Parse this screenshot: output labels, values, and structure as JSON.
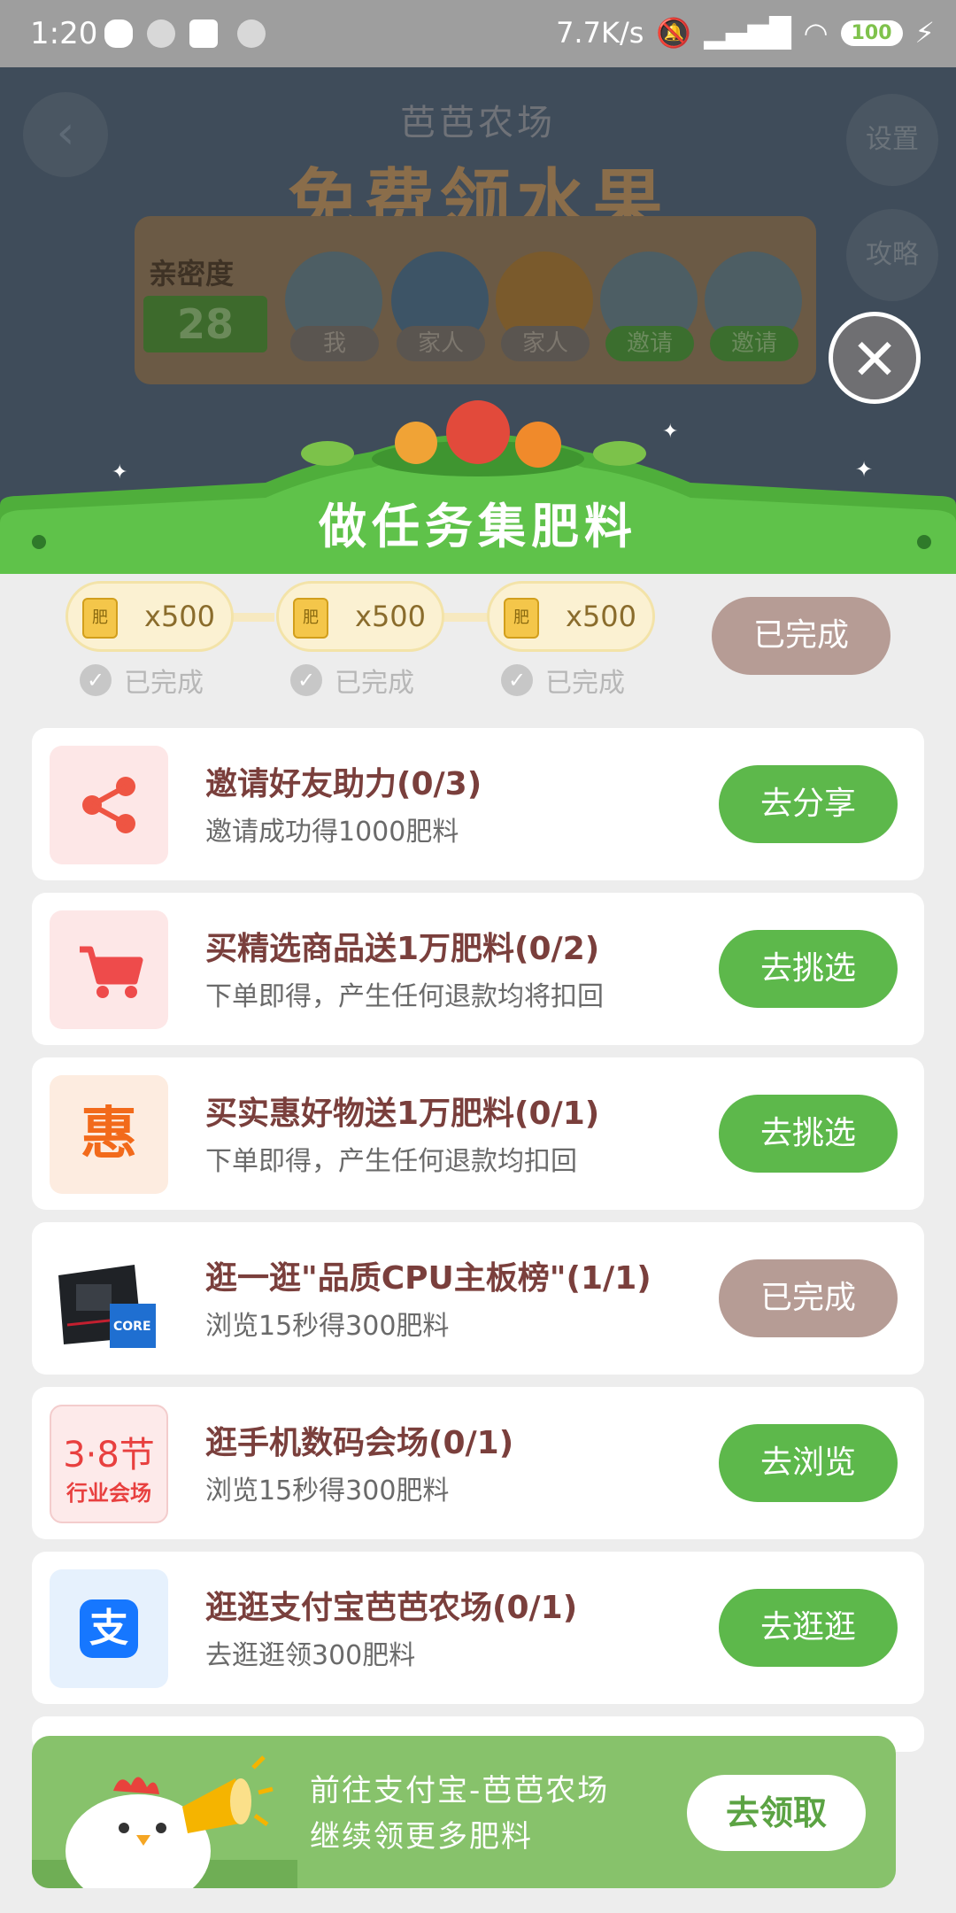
{
  "status_bar": {
    "time": "1:20",
    "net_speed": "7.7K/s",
    "battery": "100"
  },
  "background_game": {
    "app_name": "芭芭农场",
    "headline": "免费领水果",
    "settings_label": "设置",
    "guide_label": "攻略",
    "intimacy_label": "亲密度",
    "intimacy_value": "28",
    "members": [
      {
        "label": "我"
      },
      {
        "label": "家人"
      },
      {
        "label": "家人"
      },
      {
        "label": "邀请"
      },
      {
        "label": "邀请"
      }
    ]
  },
  "sheet": {
    "title": "做任务集肥料",
    "fert_icon_text": "肥",
    "progress": [
      {
        "amount": "x500",
        "status": "已完成"
      },
      {
        "amount": "x500",
        "status": "已完成"
      },
      {
        "amount": "x500",
        "status": "已完成"
      }
    ],
    "progress_button": "已完成",
    "tasks": [
      {
        "title": "邀请好友助力(0/3)",
        "subtitle": "邀请成功得1000肥料",
        "action": "去分享",
        "icon": "share-icon"
      },
      {
        "title": "买精选商品送1万肥料(0/2)",
        "subtitle": "下单即得，产生任何退款均将扣回",
        "action": "去挑选",
        "icon": "cart-icon"
      },
      {
        "title": "买实惠好物送1万肥料(0/1)",
        "subtitle": "下单即得，产生任何退款均扣回",
        "action": "去挑选",
        "icon": "hui-icon",
        "icon_text": "惠"
      },
      {
        "title": "逛一逛\"品质CPU主板榜\"(1/1)",
        "subtitle": "浏览15秒得300肥料",
        "action": "已完成",
        "icon": "motherboard-image",
        "icon_text": "CORE i7"
      },
      {
        "title": "逛手机数码会场(0/1)",
        "subtitle": "浏览15秒得300肥料",
        "action": "去浏览",
        "icon": "38-festival-icon",
        "icon_text": "3·8节",
        "icon_text2": "行业会场"
      },
      {
        "title": "逛逛支付宝芭芭农场(0/1)",
        "subtitle": "去逛逛领300肥料",
        "action": "去逛逛",
        "icon": "alipay-icon",
        "icon_text": "支"
      }
    ]
  },
  "banner": {
    "line1": "前往支付宝-芭芭农场",
    "line2": "继续领更多肥料",
    "button": "去领取"
  },
  "colors": {
    "accent_green": "#5db84b",
    "done_brown": "#b69c95",
    "title_brown": "#7a3f3c"
  }
}
